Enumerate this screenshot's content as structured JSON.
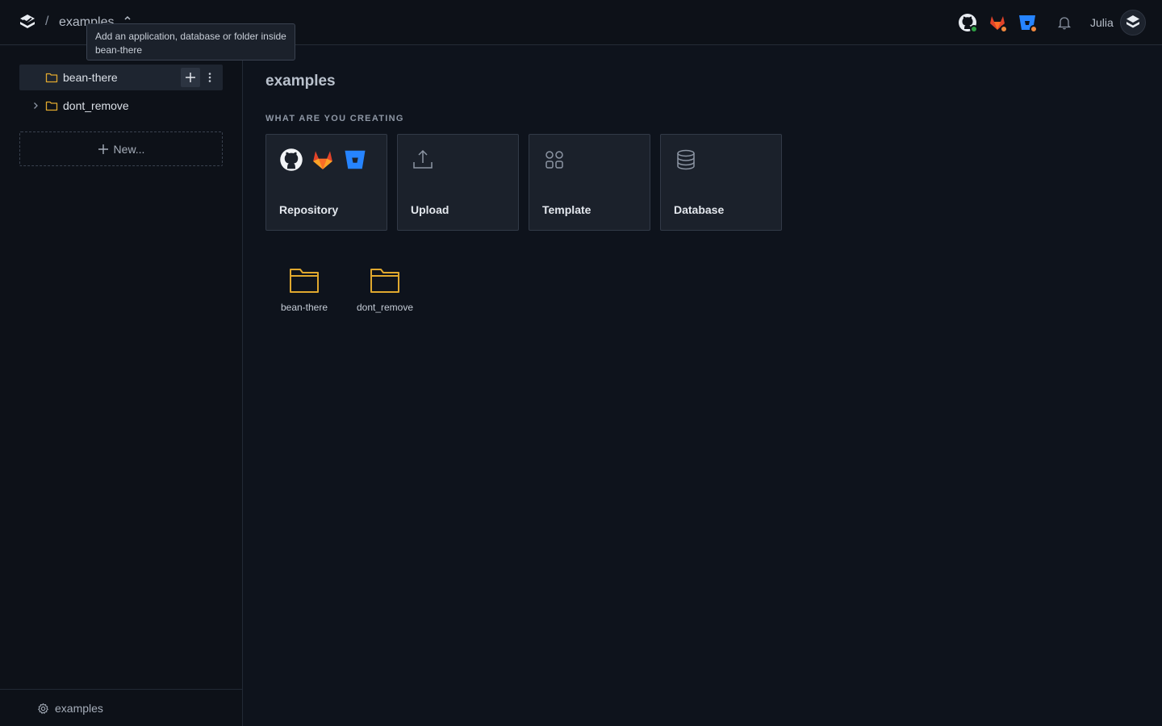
{
  "topbar": {
    "breadcrumb_separator": "/",
    "breadcrumb_project": "examples",
    "user_name": "Julia",
    "status_colors": {
      "github": "#2ea043",
      "gitlab": "#f0883e",
      "bitbucket": "#f0883e"
    }
  },
  "tooltip": {
    "text": "Add an application, database or folder inside bean-there"
  },
  "sidebar": {
    "items": [
      {
        "label": "bean-there",
        "icon": "folder-icon",
        "active": true,
        "expandable": false
      },
      {
        "label": "dont_remove",
        "icon": "folder-icon",
        "active": false,
        "expandable": true
      }
    ],
    "new_button_label": "New...",
    "footer_label": "examples"
  },
  "main": {
    "title": "examples",
    "section_label": "WHAT ARE YOU CREATING",
    "cards": [
      {
        "label": "Repository",
        "icons": [
          "github-icon",
          "gitlab-icon",
          "bitbucket-icon"
        ]
      },
      {
        "label": "Upload",
        "icons": [
          "upload-icon"
        ]
      },
      {
        "label": "Template",
        "icons": [
          "template-grid-icon"
        ]
      },
      {
        "label": "Database",
        "icons": [
          "database-icon"
        ]
      }
    ],
    "folders": [
      {
        "label": "bean-there"
      },
      {
        "label": "dont_remove"
      }
    ]
  },
  "colors": {
    "background": "#0e131c",
    "folder_accent": "#e0a82e",
    "gitlab_orange": "#fc6d26",
    "bitbucket_blue": "#2684ff"
  }
}
